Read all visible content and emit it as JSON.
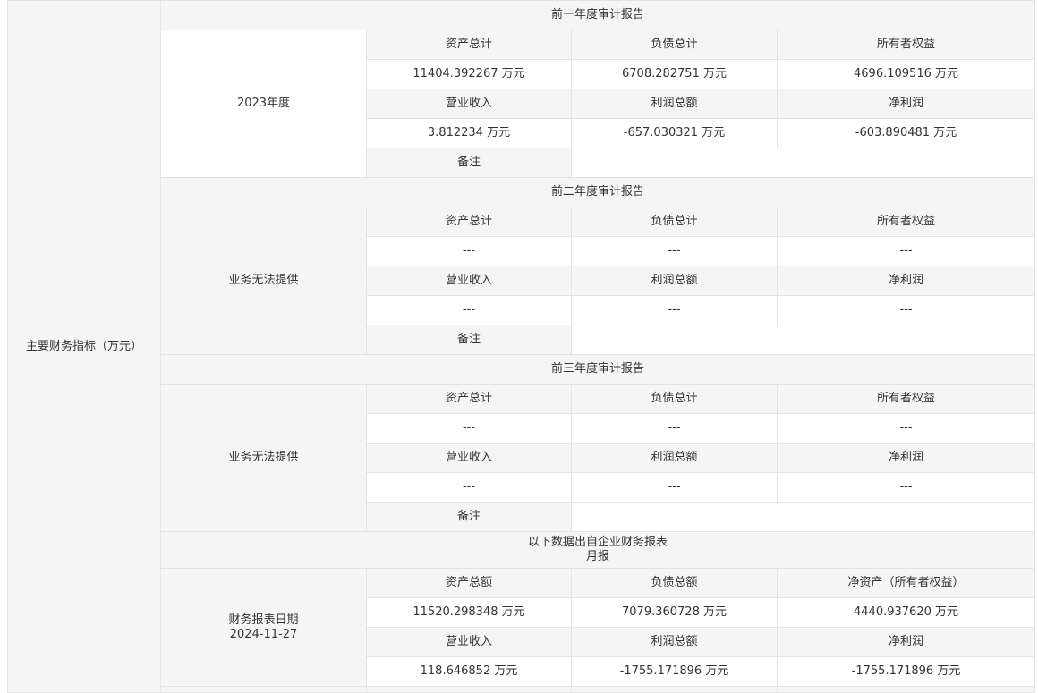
{
  "main_label": "主要财务指标（万元）",
  "labels": {
    "assets": "资产总计",
    "liabilities": "负债总计",
    "equity": "所有者权益",
    "revenue": "营业收入",
    "total_profit": "利润总额",
    "net_profit": "净利润",
    "remark": "备注"
  },
  "years": [
    {
      "title": "前一年度审计报告",
      "period": "2023年度",
      "assets": "11404.392267 万元",
      "liabilities": "6708.282751 万元",
      "equity": "4696.109516 万元",
      "revenue": "3.812234 万元",
      "total_profit": "-657.030321 万元",
      "net_profit": "-603.890481 万元",
      "remark": ""
    },
    {
      "title": "前二年度审计报告",
      "period": "业务无法提供",
      "assets": "---",
      "liabilities": "---",
      "equity": "---",
      "revenue": "---",
      "total_profit": "---",
      "net_profit": "---",
      "remark": ""
    },
    {
      "title": "前三年度审计报告",
      "period": "业务无法提供",
      "assets": "---",
      "liabilities": "---",
      "equity": "---",
      "revenue": "---",
      "total_profit": "---",
      "net_profit": "---",
      "remark": ""
    }
  ],
  "report": {
    "title_line1": "以下数据出自企业财务报表",
    "title_line2": "月报",
    "date_label": "财务报表日期",
    "date": "2024-11-27",
    "labels": {
      "assets": "资产总额",
      "liabilities": "负债总额",
      "equity": "净资产（所有者权益）",
      "revenue": "营业收入",
      "total_profit": "利润总额",
      "net_profit": "净利润"
    },
    "assets": "11520.298348 万元",
    "liabilities": "7079.360728 万元",
    "equity": "4440.937620 万元",
    "revenue": "118.646852 万元",
    "total_profit": "-1755.171896 万元",
    "net_profit": "-1755.171896 万元"
  }
}
